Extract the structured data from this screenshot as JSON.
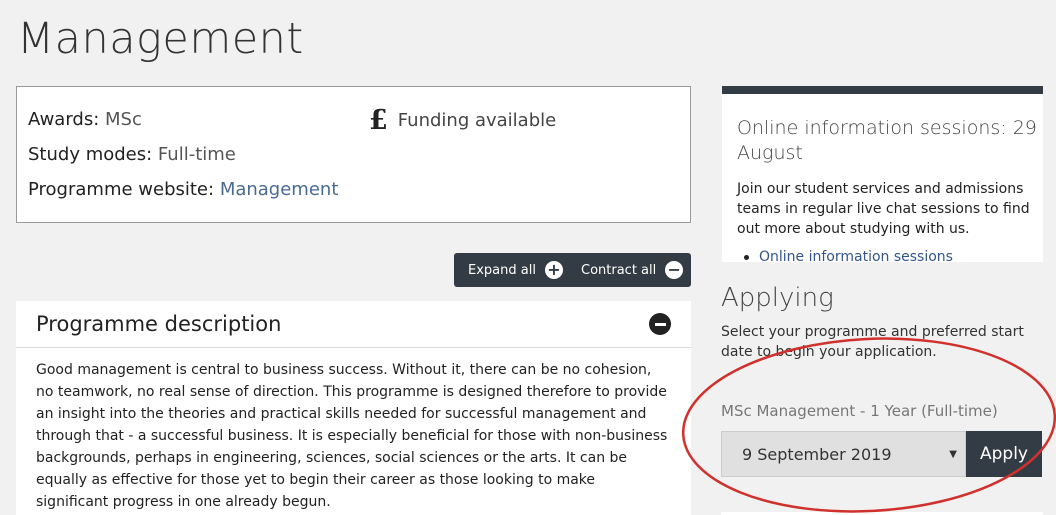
{
  "page": {
    "title": "Management"
  },
  "facts": {
    "awards_label": "Awards:",
    "awards_value": "MSc",
    "study_modes_label": "Study modes:",
    "study_modes_value": "Full-time",
    "website_label": "Programme website:",
    "website_value": "Management",
    "funding_text": "Funding available",
    "funding_icon": "pound-icon"
  },
  "toggles": {
    "expand_label": "Expand all",
    "contract_label": "Contract all"
  },
  "description": {
    "title": "Programme description",
    "body": "Good management is central to business success. Without it, there can be no cohesion, no teamwork, no real sense of direction. This programme is designed therefore to provide an insight into the theories and practical skills needed for successful management and through that - a successful business. It is especially beneficial for those with non-business backgrounds, perhaps in engineering, sciences, social sciences or the arts. It can be equally as effective for those yet to begin their career as those looking to make significant progress in one already begun."
  },
  "info": {
    "title": "Online information sessions: 29 August",
    "text": "Join our student services and admissions teams in regular live chat sessions to find out more about studying with us.",
    "link": "Online information sessions"
  },
  "applying": {
    "heading": "Applying",
    "text": "Select your programme and preferred start date to begin your application.",
    "programme_label": "MSc Management - 1 Year (Full-time)",
    "start_date_selected": "9 September 2019",
    "apply_label": "Apply"
  },
  "colors": {
    "dark_bar": "#333c44",
    "link": "#33558a",
    "annotation": "#d0312d"
  }
}
